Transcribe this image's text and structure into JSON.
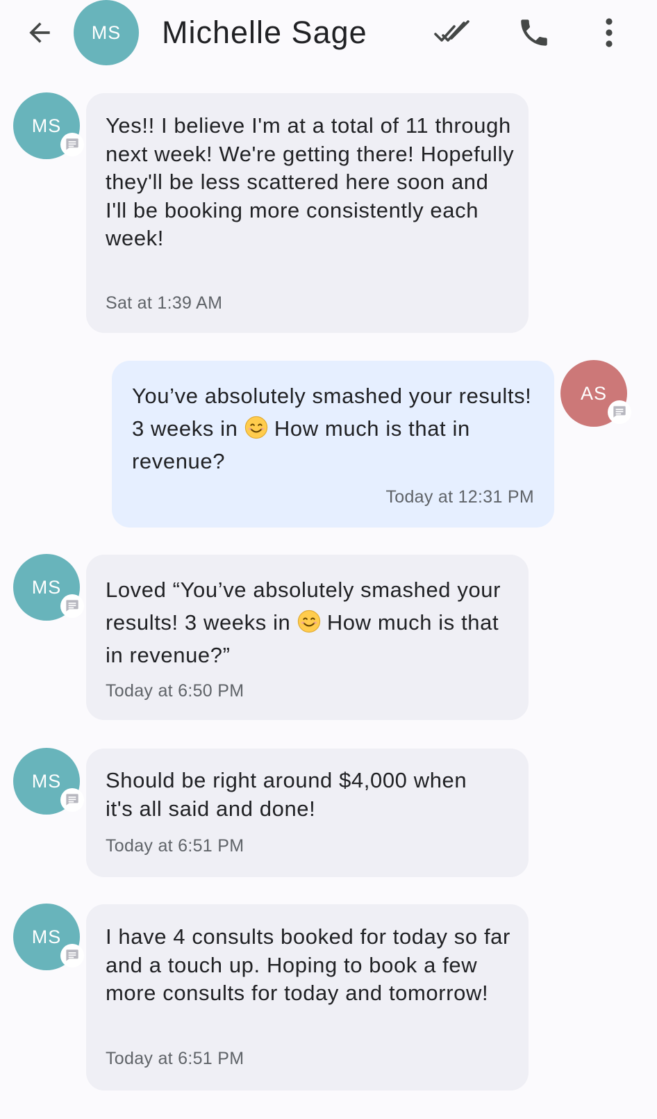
{
  "header": {
    "avatar_initials": "MS",
    "contact_name": "Michelle Sage",
    "icons": {
      "back": "arrow-left-icon",
      "read": "double-check-icon",
      "call": "phone-icon",
      "more": "more-vert-icon"
    }
  },
  "messages": [
    {
      "direction": "incoming",
      "sender_initials": "MS",
      "text": "Yes!! I believe I'm at a total of 11 through next week! We're getting there! Hopefully they'll be less scattered here soon and I'll be booking more consistently each week!",
      "time": "Sat at 1:39 AM"
    },
    {
      "direction": "outgoing",
      "sender_initials": "AS",
      "text_before_emoji": "You’ve absolutely smashed your results! 3 weeks in ",
      "emoji": "smiling-face-icon",
      "text_after_emoji": " How much is that in revenue?",
      "time": "Today at 12:31 PM"
    },
    {
      "direction": "incoming",
      "sender_initials": "MS",
      "text_before_emoji": "Loved “You’ve absolutely smashed your results! 3 weeks in ",
      "emoji": "smiling-face-icon",
      "text_after_emoji": " How much is that in revenue?”",
      "time": "Today at 6:50 PM"
    },
    {
      "direction": "incoming",
      "sender_initials": "MS",
      "text": "Should be right around $4,000 when it's all said and done!",
      "time": "Today at 6:51 PM"
    },
    {
      "direction": "incoming",
      "sender_initials": "MS",
      "text": "I have 4 consults booked for today so far and a touch up. Hoping to book a few more consults for today and tomorrow!",
      "time": "Today at 6:51 PM"
    }
  ],
  "colors": {
    "background": "#fbfafd",
    "incoming_bubble": "#efeff5",
    "outgoing_bubble": "#e6efff",
    "ms_avatar": "#68b4bb",
    "as_avatar": "#cc7878",
    "icon": "#444746",
    "timestamp": "#5f6368"
  }
}
